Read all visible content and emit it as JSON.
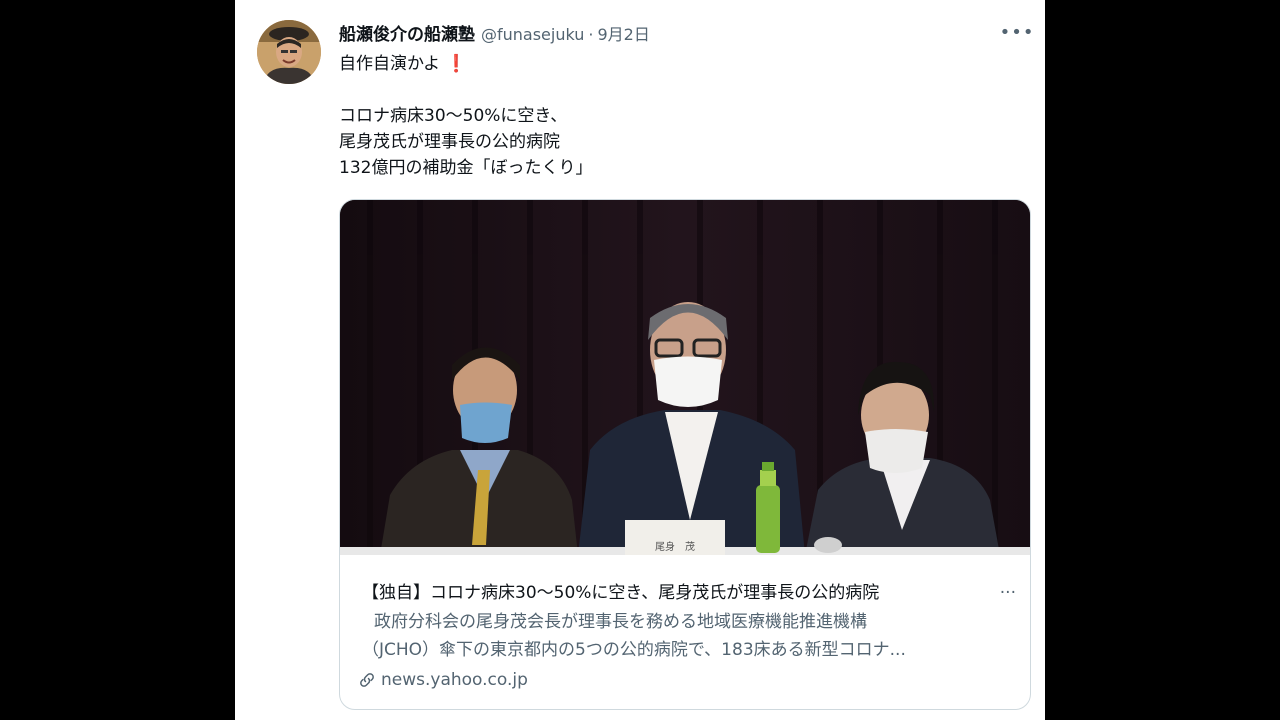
{
  "tweet": {
    "author_name": "船瀬俊介の船瀬塾",
    "handle": "@funasejuku",
    "separator": "·",
    "date": "9月2日",
    "more_label": "•••",
    "text_line1": "自作自演かよ",
    "exclamation": "❗",
    "text_line2": "コロナ病床30～50%に空き、",
    "text_line3": "尾身茂氏が理事長の公的病院",
    "text_line4": "132億円の補助金「ぼったくり」"
  },
  "card": {
    "image_placard": "尾身　茂",
    "title": "【独自】コロナ病床30～50%に空き、尾身茂氏が理事長の公的病院",
    "title_ellipsis": "...",
    "description_line1": "政府分科会の尾身茂会長が理事長を務める地域医療機能推進機構",
    "description_line2": "（JCHO）傘下の東京都内の5つの公的病院で、183床ある新型コロナ...",
    "domain": "news.yahoo.co.jp",
    "link_icon": "link-icon"
  },
  "colors": {
    "background": "#000000",
    "card_border": "#cfd9de",
    "secondary_text": "#536471",
    "primary_text": "#0f1419",
    "exclamation": "#d4202f"
  }
}
